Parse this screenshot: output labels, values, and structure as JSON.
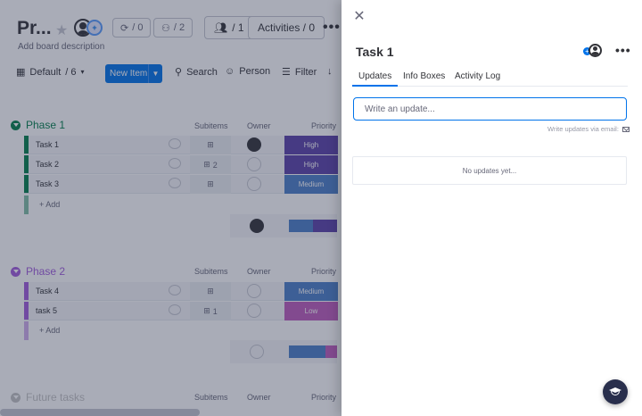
{
  "board": {
    "title": "Pr...",
    "description": "Add board description",
    "header": {
      "invite_badge": "+",
      "integrations_count": "/ 0",
      "automations_count": "/ 2",
      "members_count": "/ 1",
      "activities_label": "Activities / 0",
      "more": "•••"
    },
    "toolbar": {
      "view_label": "Default",
      "view_count": "/ 6",
      "new_item": "New Item",
      "search": "Search",
      "person": "Person",
      "filter": "Filter",
      "sort": "↓"
    },
    "groups": [
      {
        "name": "Phase 1",
        "color": "#037f4c",
        "columns": {
          "subitems": "Subitems",
          "owner": "Owner",
          "priority": "Priority"
        },
        "items": [
          {
            "name": "Task 1",
            "subitems": "",
            "owner_assigned": true,
            "priority": "High",
            "priority_color": "#5b42a8"
          },
          {
            "name": "Task 2",
            "subitems": "2",
            "owner_assigned": false,
            "priority": "High",
            "priority_color": "#5b42a8"
          },
          {
            "name": "Task 3",
            "subitems": "",
            "owner_assigned": false,
            "priority": "Medium",
            "priority_color": "#4c7fc9"
          }
        ],
        "add_item": "+ Add"
      },
      {
        "name": "Phase 2",
        "color": "#a25ddc",
        "columns": {
          "subitems": "Subitems",
          "owner": "Owner",
          "priority": "Priority"
        },
        "items": [
          {
            "name": "Task 4",
            "subitems": "",
            "owner_assigned": false,
            "priority": "Medium",
            "priority_color": "#4c7fc9"
          },
          {
            "name": "task 5",
            "subitems": "1",
            "owner_assigned": false,
            "priority": "Low",
            "priority_color": "#bf5cbc"
          }
        ],
        "add_item": "+ Add"
      },
      {
        "name": "Future tasks",
        "color": "#c4c4c4",
        "columns": {
          "subitems": "Subitems",
          "owner": "Owner",
          "priority": "Priority"
        }
      }
    ]
  },
  "panel": {
    "close": "✕",
    "item_title": "Task 1",
    "subscriber_plus": "+",
    "more": "•••",
    "tabs": [
      {
        "label": "Updates",
        "active": true
      },
      {
        "label": "Info Boxes",
        "active": false
      },
      {
        "label": "Activity Log",
        "active": false
      }
    ],
    "update_placeholder": "Write an update...",
    "email_note": "Write updates via email:",
    "empty_text": "No updates yet..."
  },
  "colors": {
    "accent": "#0073ea",
    "dark": "#323338",
    "overlay": "#292f4c"
  }
}
